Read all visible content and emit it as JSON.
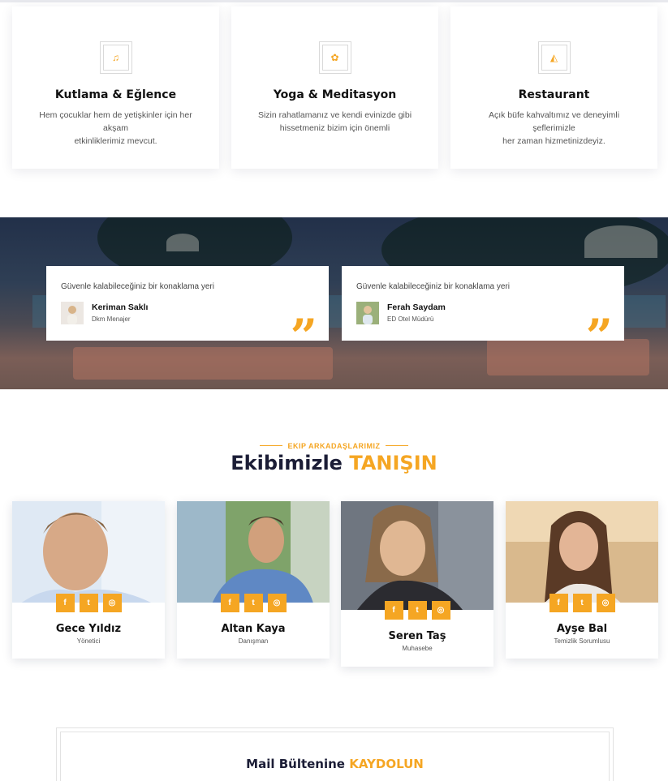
{
  "colors": {
    "accent": "#f5a623",
    "dark": "#1b1d36"
  },
  "services": [
    {
      "icon": "music-note-icon",
      "glyph": "♫",
      "title": "Kutlama & Eğlence",
      "desc_line1": "Hem çocuklar hem de yetişkinler için her akşam",
      "desc_line2": "etkinliklerimiz mevcut."
    },
    {
      "icon": "lotus-icon",
      "glyph": "✿",
      "title": "Yoga & Meditasyon",
      "desc_line1": "Sizin rahatlamanız ve kendi evinizde gibi",
      "desc_line2": "hissetmeniz bizim için önemli"
    },
    {
      "icon": "pizza-icon",
      "glyph": "◭",
      "title": "Restaurant",
      "desc_line1": "Açık büfe kahvaltımız ve deneyimli şeflerimizle",
      "desc_line2": "her zaman hizmetinizdeyiz."
    }
  ],
  "testimonials": [
    {
      "text": "Güvenle kalabileceğiniz bir konaklama yeri",
      "name": "Keriman Saklı",
      "role": "Dkm Menajer",
      "quote_glyph": "”"
    },
    {
      "text": "Güvenle kalabileceğiniz bir konaklama yeri",
      "name": "Ferah Saydam",
      "role": "ED Otel Müdürü",
      "quote_glyph": "”"
    }
  ],
  "team": {
    "eyebrow": "EKIP ARKADAŞLARIMIZ",
    "title_main": "Ekibimizle ",
    "title_accent": "TANIŞIN",
    "members": [
      {
        "name": "Gece Yıldız",
        "role": "Yönetici"
      },
      {
        "name": "Altan Kaya",
        "role": "Danışman"
      },
      {
        "name": "Seren Taş",
        "role": "Muhasebe"
      },
      {
        "name": "Ayşe Bal",
        "role": "Temizlik Sorumlusu"
      }
    ],
    "social": {
      "facebook": "f",
      "twitter": "t",
      "instagram": "◎"
    }
  },
  "newsletter": {
    "title_main": "Mail Bültenine ",
    "title_accent": "KAYDOLUN"
  }
}
